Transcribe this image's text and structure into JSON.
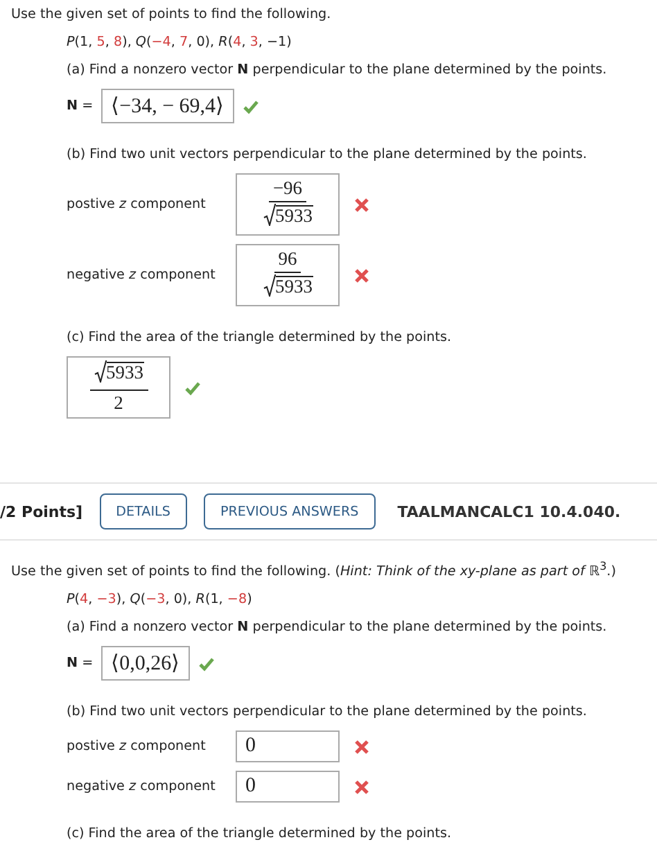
{
  "problems": [
    {
      "intro": "Use the given set of points to find the following.",
      "points": [
        {
          "text": "*P*(1, ",
          "highlighted": false
        },
        {
          "text": "5",
          "highlighted": true
        },
        {
          "text": ", ",
          "highlighted": false
        },
        {
          "text": "8",
          "highlighted": true
        },
        {
          "text": "), *Q*(",
          "highlighted": false
        },
        {
          "text": "−4",
          "highlighted": true
        },
        {
          "text": ", ",
          "highlighted": false
        },
        {
          "text": "7",
          "highlighted": true
        },
        {
          "text": ", 0), *R*(",
          "highlighted": false
        },
        {
          "text": "4",
          "highlighted": true
        },
        {
          "text": ", ",
          "highlighted": false
        },
        {
          "text": "3",
          "highlighted": true
        },
        {
          "text": ", −1)",
          "highlighted": false
        }
      ],
      "parts": [
        {
          "kind": "vector",
          "prompt": "(a) Find a nonzero vector **N** perpendicular to the plane determined by the points.",
          "rows": [
            {
              "label": "**N** =",
              "answer": {
                "kind": "plain",
                "text": "⟨−34, − 69,4⟩"
              },
              "correct": true
            }
          ]
        },
        {
          "kind": "components",
          "prompt": "(b) Find two unit vectors perpendicular to the plane determined by the points.",
          "rows": [
            {
              "label": "postive *z* component",
              "answer": {
                "kind": "fraction",
                "numerator": {
                  "text": "−96",
                  "radical": false
                },
                "denominator": {
                  "text": "5933",
                  "radical": true
                }
              },
              "correct": false
            },
            {
              "label": "negative *z* component",
              "answer": {
                "kind": "fraction",
                "numerator": {
                  "text": "96",
                  "radical": false
                },
                "denominator": {
                  "text": "5933",
                  "radical": true
                }
              },
              "correct": false
            }
          ]
        },
        {
          "kind": "area",
          "prompt": "(c) Find the area of the triangle determined by the points.",
          "rows": [
            {
              "answer": {
                "kind": "fraction",
                "numerator": {
                  "text": "5933",
                  "radical": true
                },
                "denominator": {
                  "text": "2",
                  "radical": false
                }
              },
              "correct": true
            }
          ]
        }
      ]
    },
    {
      "header": {
        "points": "/2 Points]",
        "buttons": [
          "DETAILS",
          "PREVIOUS ANSWERS"
        ],
        "problem_id": "TAALMANCALC1 10.4.040."
      },
      "intro": "Use the given set of points to find the following. (*Hint: Think of the xy-plane as part of* ℝ$^{3}$.)",
      "points": [
        {
          "text": "*P*(",
          "highlighted": false
        },
        {
          "text": "4",
          "highlighted": true
        },
        {
          "text": ", ",
          "highlighted": false
        },
        {
          "text": "−3",
          "highlighted": true
        },
        {
          "text": "), *Q*(",
          "highlighted": false
        },
        {
          "text": "−3",
          "highlighted": true
        },
        {
          "text": ", 0), *R*(1, ",
          "highlighted": false
        },
        {
          "text": "−8",
          "highlighted": true
        },
        {
          "text": ")",
          "highlighted": false
        }
      ],
      "parts": [
        {
          "kind": "vector",
          "prompt": "(a) Find a nonzero vector **N** perpendicular to the plane determined by the points.",
          "rows": [
            {
              "label": "**N** =",
              "answer": {
                "kind": "plain",
                "text": "⟨0,0,26⟩"
              },
              "correct": true
            }
          ]
        },
        {
          "kind": "components",
          "prompt": "(b) Find two unit vectors perpendicular to the plane determined by the points.",
          "rows": [
            {
              "label": "postive *z* component",
              "answer": {
                "kind": "plain",
                "text": "0"
              },
              "correct": false
            },
            {
              "label": "negative *z* component",
              "answer": {
                "kind": "plain",
                "text": "0"
              },
              "correct": false
            }
          ]
        },
        {
          "kind": "area",
          "prompt": "(c) Find the area of the triangle determined by the points."
        }
      ]
    }
  ]
}
